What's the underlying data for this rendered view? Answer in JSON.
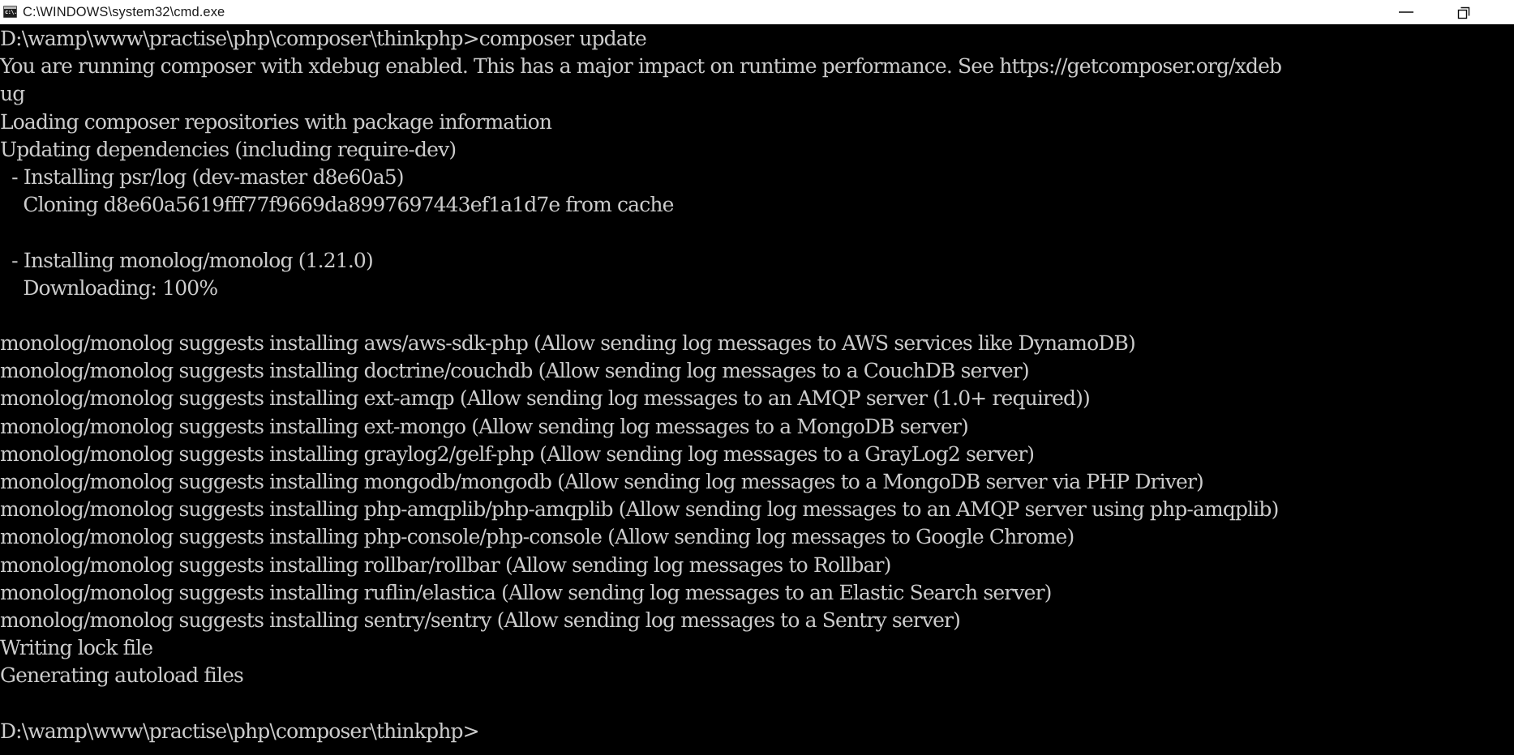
{
  "window": {
    "title": "C:\\WINDOWS\\system32\\cmd.exe",
    "icon": "cmd-console-icon",
    "icon_glyph": "c:\\.",
    "titlebar_bg": "#ffffff",
    "titlebar_fg": "#1a1a1a",
    "controls": {
      "minimize_label": "—",
      "minimize_name": "minimize-button",
      "restore_label": "❐",
      "restore_name": "restore-button"
    }
  },
  "terminal": {
    "background": "#000000",
    "foreground": "#cccccc",
    "columns": 130,
    "prompt_path": "D:\\wamp\\www\\practise\\php\\composer\\thinkphp>",
    "command": "composer update",
    "lines": [
      "D:\\wamp\\www\\practise\\php\\composer\\thinkphp>composer update",
      "You are running composer with xdebug enabled. This has a major impact on runtime performance. See https://getcomposer.org/xdeb",
      "ug",
      "Loading composer repositories with package information",
      "Updating dependencies (including require-dev)",
      "  - Installing psr/log (dev-master d8e60a5)",
      "    Cloning d8e60a5619fff77f9669da8997697443ef1a1d7e from cache",
      "",
      "  - Installing monolog/monolog (1.21.0)",
      "    Downloading: 100%",
      "",
      "monolog/monolog suggests installing aws/aws-sdk-php (Allow sending log messages to AWS services like DynamoDB)",
      "monolog/monolog suggests installing doctrine/couchdb (Allow sending log messages to a CouchDB server)",
      "monolog/monolog suggests installing ext-amqp (Allow sending log messages to an AMQP server (1.0+ required))",
      "monolog/monolog suggests installing ext-mongo (Allow sending log messages to a MongoDB server)",
      "monolog/monolog suggests installing graylog2/gelf-php (Allow sending log messages to a GrayLog2 server)",
      "monolog/monolog suggests installing mongodb/mongodb (Allow sending log messages to a MongoDB server via PHP Driver)",
      "monolog/monolog suggests installing php-amqplib/php-amqplib (Allow sending log messages to an AMQP server using php-amqplib)",
      "monolog/monolog suggests installing php-console/php-console (Allow sending log messages to Google Chrome)",
      "monolog/monolog suggests installing rollbar/rollbar (Allow sending log messages to Rollbar)",
      "monolog/monolog suggests installing ruflin/elastica (Allow sending log messages to an Elastic Search server)",
      "monolog/monolog suggests installing sentry/sentry (Allow sending log messages to a Sentry server)",
      "Writing lock file",
      "Generating autoload files",
      "",
      "D:\\wamp\\www\\practise\\php\\composer\\thinkphp>"
    ]
  }
}
